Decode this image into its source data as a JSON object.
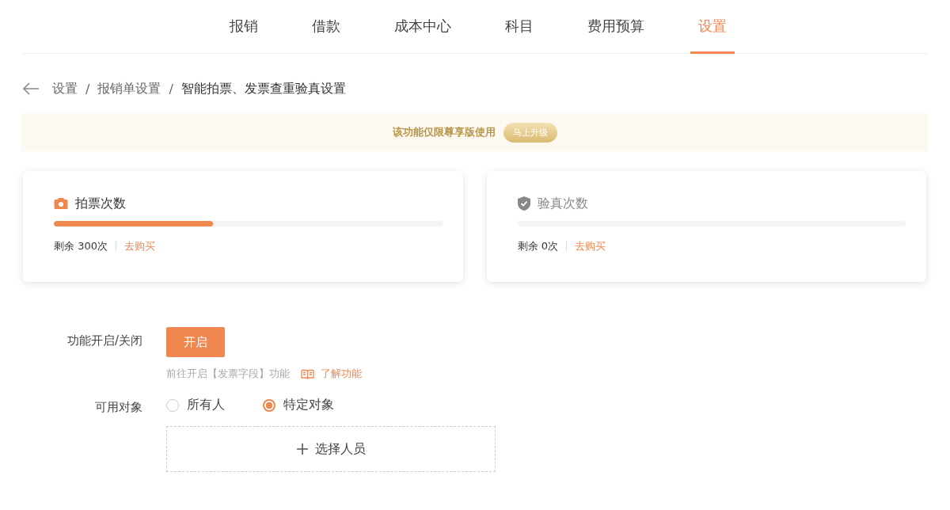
{
  "tabs": [
    {
      "label": "报销",
      "selected": false
    },
    {
      "label": "借款",
      "selected": false
    },
    {
      "label": "成本中心",
      "selected": false
    },
    {
      "label": "科目",
      "selected": false
    },
    {
      "label": "费用预算",
      "selected": false
    },
    {
      "label": "设置",
      "selected": true
    }
  ],
  "breadcrumb": [
    "设置",
    "/",
    "报销单设置",
    "/",
    "智能拍票、发票查重验真设置"
  ],
  "banner": {
    "text": "该功能仅限尊享版使用",
    "button": "马上升级"
  },
  "cards": [
    {
      "kind": "camera",
      "title": "拍票次数",
      "disabled": false,
      "level": 0.41,
      "remaining": "剩余 300次",
      "link": "去购买"
    },
    {
      "kind": "shield",
      "title": "验真次数",
      "disabled": true,
      "remaining": "剩余 0次",
      "link": "去购买"
    }
  ],
  "toggle": {
    "label": "功能开启/关闭",
    "button": "开启",
    "hint": "前往开启【发票字段】功能",
    "link": "了解功能"
  },
  "audience": {
    "label": "可用对象",
    "options": [
      {
        "label": "所有人",
        "selected": false
      },
      {
        "label": "特定对象",
        "selected": true
      }
    ],
    "picker": "选择人员"
  }
}
